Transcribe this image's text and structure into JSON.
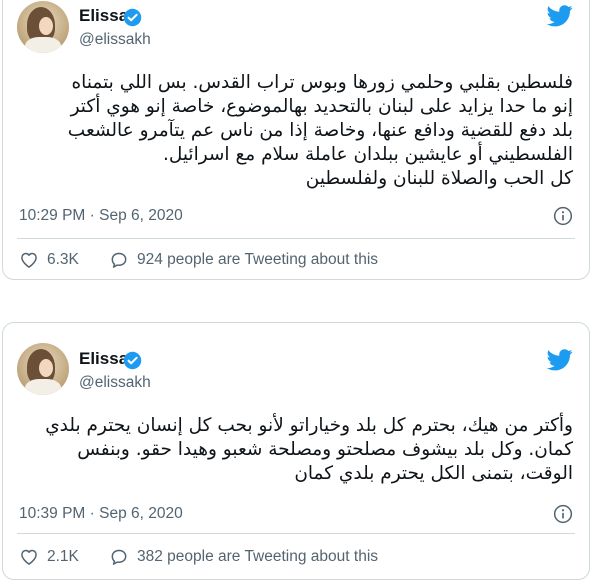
{
  "tweets": [
    {
      "author": {
        "name": "Elissa",
        "handle": "@elissakh"
      },
      "text": "فلسطين بقلبي وحلمي زورها وبوس تراب القدس. بس اللي بتمناه\nإنو ما حدا يزايد على لبنان بالتحديد بهالموضوع، خاصة إنو هوي أكتر\nبلد دفع للقضية ودافع عنها، وخاصة إذا من ناس عم يتآمرو عالشعب\nالفلسطيني أو عايشين ببلدان عاملة سلام مع اسرائيل.\nكل الحب والصلاة للبنان ولفلسطين",
      "timestamp": "10:29 PM · Sep 6, 2020",
      "likes": "6.3K",
      "conversation": "924 people are Tweeting about this"
    },
    {
      "author": {
        "name": "Elissa",
        "handle": "@elissakh"
      },
      "text": "وأكتر من هيك، بحترم كل بلد وخياراتو لأنو بحب كل إنسان يحترم بلدي\nكمان. وكل بلد بيشوف مصلحتو ومصلحة شعبو وهيدا حقو. وبنفس\nالوقت، بتمنى الكل يحترم بلدي كمان",
      "timestamp": "10:39 PM · Sep 6, 2020",
      "likes": "2.1K",
      "conversation": "382 people are Tweeting about this"
    }
  ],
  "colors": {
    "brand": "#1d9bf0",
    "secondary_text": "#536471",
    "primary_text": "#0f1419",
    "border": "#cfd9de"
  },
  "icons": [
    "verified-badge-icon",
    "twitter-bird-icon",
    "info-icon",
    "heart-icon",
    "speech-bubble-icon"
  ]
}
